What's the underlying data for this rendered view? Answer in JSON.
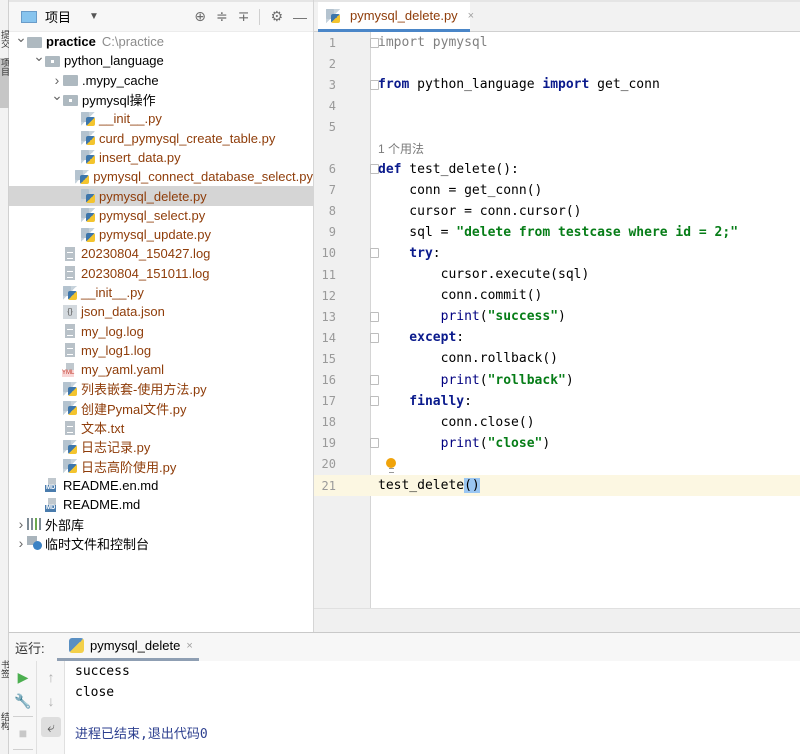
{
  "left_strip": {
    "tabs": [
      {
        "label": "提交",
        "active": false
      },
      {
        "label": "项目",
        "active": true
      },
      {
        "label": "书签",
        "active": false
      },
      {
        "label": "结构",
        "active": false
      }
    ]
  },
  "project_panel": {
    "title": "项目",
    "header_icons": [
      "locate-icon",
      "expand-all-icon",
      "collapse-all-icon",
      "gear-icon",
      "minimize-icon"
    ],
    "tree": [
      {
        "level": 0,
        "arrow": "down",
        "icon": "folder",
        "name": "practice",
        "path": "C:\\practice",
        "style": "bold"
      },
      {
        "level": 1,
        "arrow": "down",
        "icon": "package",
        "name": "python_language",
        "style": "dir"
      },
      {
        "level": 2,
        "arrow": "right",
        "icon": "folder",
        "name": ".mypy_cache",
        "style": "dir"
      },
      {
        "level": 2,
        "arrow": "down",
        "icon": "package",
        "name": "pymysql操作",
        "style": "dir"
      },
      {
        "level": 3,
        "icon": "python",
        "name": "__init__.py",
        "style": "modified"
      },
      {
        "level": 3,
        "icon": "python",
        "name": "curd_pymysql_create_table.py",
        "style": "modified"
      },
      {
        "level": 3,
        "icon": "python",
        "name": "insert_data.py",
        "style": "modified"
      },
      {
        "level": 3,
        "icon": "python",
        "name": "pymysql_connect_database_select.py",
        "style": "modified"
      },
      {
        "level": 3,
        "icon": "python",
        "name": "pymysql_delete.py",
        "style": "modified",
        "selected": true
      },
      {
        "level": 3,
        "icon": "python",
        "name": "pymysql_select.py",
        "style": "modified"
      },
      {
        "level": 3,
        "icon": "python",
        "name": "pymysql_update.py",
        "style": "modified"
      },
      {
        "level": 2,
        "icon": "log",
        "name": "20230804_150427.log",
        "style": "modified"
      },
      {
        "level": 2,
        "icon": "log",
        "name": "20230804_151011.log",
        "style": "modified"
      },
      {
        "level": 2,
        "icon": "python",
        "name": "__init__.py",
        "style": "modified"
      },
      {
        "level": 2,
        "icon": "json",
        "name": "json_data.json",
        "style": "modified"
      },
      {
        "level": 2,
        "icon": "log",
        "name": "my_log.log",
        "style": "modified"
      },
      {
        "level": 2,
        "icon": "log",
        "name": "my_log1.log",
        "style": "modified"
      },
      {
        "level": 2,
        "icon": "yaml",
        "name": "my_yaml.yaml",
        "style": "modified"
      },
      {
        "level": 2,
        "icon": "python",
        "name": "列表嵌套-使用方法.py",
        "style": "modified"
      },
      {
        "level": 2,
        "icon": "python",
        "name": "创建Pymal文件.py",
        "style": "modified"
      },
      {
        "level": 2,
        "icon": "log",
        "name": "文本.txt",
        "style": "modified"
      },
      {
        "level": 2,
        "icon": "python",
        "name": "日志记录.py",
        "style": "modified"
      },
      {
        "level": 2,
        "icon": "python",
        "name": "日志高阶使用.py",
        "style": "modified"
      },
      {
        "level": 1,
        "icon": "markdown",
        "name": "README.en.md",
        "style": "dir"
      },
      {
        "level": 1,
        "icon": "markdown",
        "name": "README.md",
        "style": "dir"
      },
      {
        "level": 0,
        "arrow": "right",
        "icon": "library",
        "name": "外部库",
        "style": "dir"
      },
      {
        "level": 0,
        "arrow": "right",
        "icon": "scratch",
        "name": "临时文件和控制台",
        "style": "dir"
      }
    ]
  },
  "editor": {
    "tab": {
      "label": "pymysql_delete.py",
      "close": "×"
    },
    "usage_hint": "1 个用法",
    "lines": [
      {
        "n": "1",
        "fold": "open",
        "tokens": [
          [
            "kwg",
            "import"
          ],
          [
            "dim",
            " pymysql"
          ]
        ]
      },
      {
        "n": "2",
        "tokens": []
      },
      {
        "n": "3",
        "fold": "close",
        "tokens": [
          [
            "kw",
            "from"
          ],
          [
            "plain",
            " python_language "
          ],
          [
            "kw",
            "import"
          ],
          [
            "plain",
            " get_conn"
          ]
        ]
      },
      {
        "n": "4",
        "tokens": []
      },
      {
        "n": "5",
        "tokens": []
      },
      {
        "n": "6",
        "fold": "open",
        "hint": true,
        "tokens": [
          [
            "kw",
            "def"
          ],
          [
            "plain",
            " test_delete():"
          ]
        ]
      },
      {
        "n": "7",
        "tokens": [
          [
            "plain",
            "    conn = get_conn()"
          ]
        ]
      },
      {
        "n": "8",
        "tokens": [
          [
            "plain",
            "    cursor = conn.cursor()"
          ]
        ]
      },
      {
        "n": "9",
        "tokens": [
          [
            "plain",
            "    sql = "
          ],
          [
            "str",
            "\"delete from testcase where id = 2;\""
          ]
        ]
      },
      {
        "n": "10",
        "fold": "open",
        "tokens": [
          [
            "kw",
            "    try"
          ],
          [
            "plain",
            ":"
          ]
        ]
      },
      {
        "n": "11",
        "tokens": [
          [
            "plain",
            "        cursor.execute(sql)"
          ]
        ]
      },
      {
        "n": "12",
        "tokens": [
          [
            "plain",
            "        conn.commit()"
          ]
        ]
      },
      {
        "n": "13",
        "fold": "close",
        "tokens": [
          [
            "builtin",
            "        print"
          ],
          [
            "plain",
            "("
          ],
          [
            "str",
            "\"success\""
          ],
          [
            "plain",
            ")"
          ]
        ]
      },
      {
        "n": "14",
        "fold": "open",
        "tokens": [
          [
            "kw",
            "    except"
          ],
          [
            "plain",
            ":"
          ]
        ]
      },
      {
        "n": "15",
        "tokens": [
          [
            "plain",
            "        conn.rollback()"
          ]
        ]
      },
      {
        "n": "16",
        "fold": "close",
        "tokens": [
          [
            "builtin",
            "        print"
          ],
          [
            "plain",
            "("
          ],
          [
            "str",
            "\"rollback\""
          ],
          [
            "plain",
            ")"
          ]
        ]
      },
      {
        "n": "17",
        "fold": "open",
        "tokens": [
          [
            "kw",
            "    finally"
          ],
          [
            "plain",
            ":"
          ]
        ]
      },
      {
        "n": "18",
        "tokens": [
          [
            "plain",
            "        conn.close()"
          ]
        ]
      },
      {
        "n": "19",
        "fold": "close",
        "tokens": [
          [
            "builtin",
            "        print"
          ],
          [
            "plain",
            "("
          ],
          [
            "str",
            "\"close\""
          ],
          [
            "plain",
            ")"
          ]
        ]
      },
      {
        "n": "20",
        "bulb": true,
        "tokens": []
      },
      {
        "n": "21",
        "current": true,
        "tokens": [
          [
            "plain",
            "test_delete"
          ],
          [
            "bracket",
            "()"
          ]
        ]
      }
    ]
  },
  "run_panel": {
    "label": "运行:",
    "tab": {
      "label": "pymysql_delete",
      "close": "×"
    },
    "output": [
      "success",
      "close"
    ],
    "exit_message": "进程已结束,退出代码0"
  }
}
